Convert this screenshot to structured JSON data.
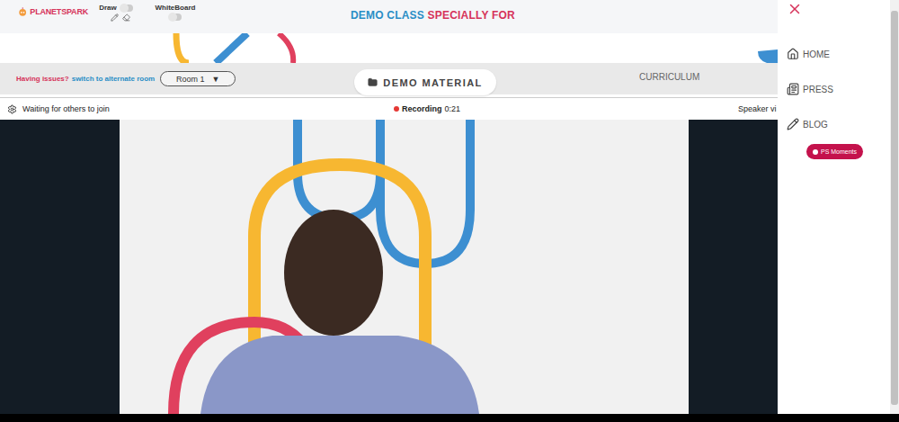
{
  "logo": {
    "text": "PLANETSPARK"
  },
  "toolbar": {
    "draw": {
      "label": "Draw",
      "on": false
    },
    "whiteboard": {
      "label": "WhiteBoard",
      "on": false
    }
  },
  "title": {
    "highlight": "DEMO CLASS",
    "rest": "SPECIALLY FOR"
  },
  "room_bar": {
    "issue_label": "Having issues?",
    "issue_link": "switch to alternate room",
    "room": "Room 1",
    "room_arrow": "▼",
    "material_button": "DEMO MATERIAL",
    "curriculum": "CURRICULUM"
  },
  "video": {
    "status": "Waiting for others to join",
    "recording": true,
    "recording_label": "Recording",
    "recording_time": "0:21",
    "view": "Speaker vi"
  },
  "menu": {
    "items": [
      {
        "label": "HOME",
        "icon": "home"
      },
      {
        "label": "PRESS",
        "icon": "press"
      },
      {
        "label": "BLOG",
        "icon": "blog"
      }
    ],
    "badge": "PS Moments"
  }
}
